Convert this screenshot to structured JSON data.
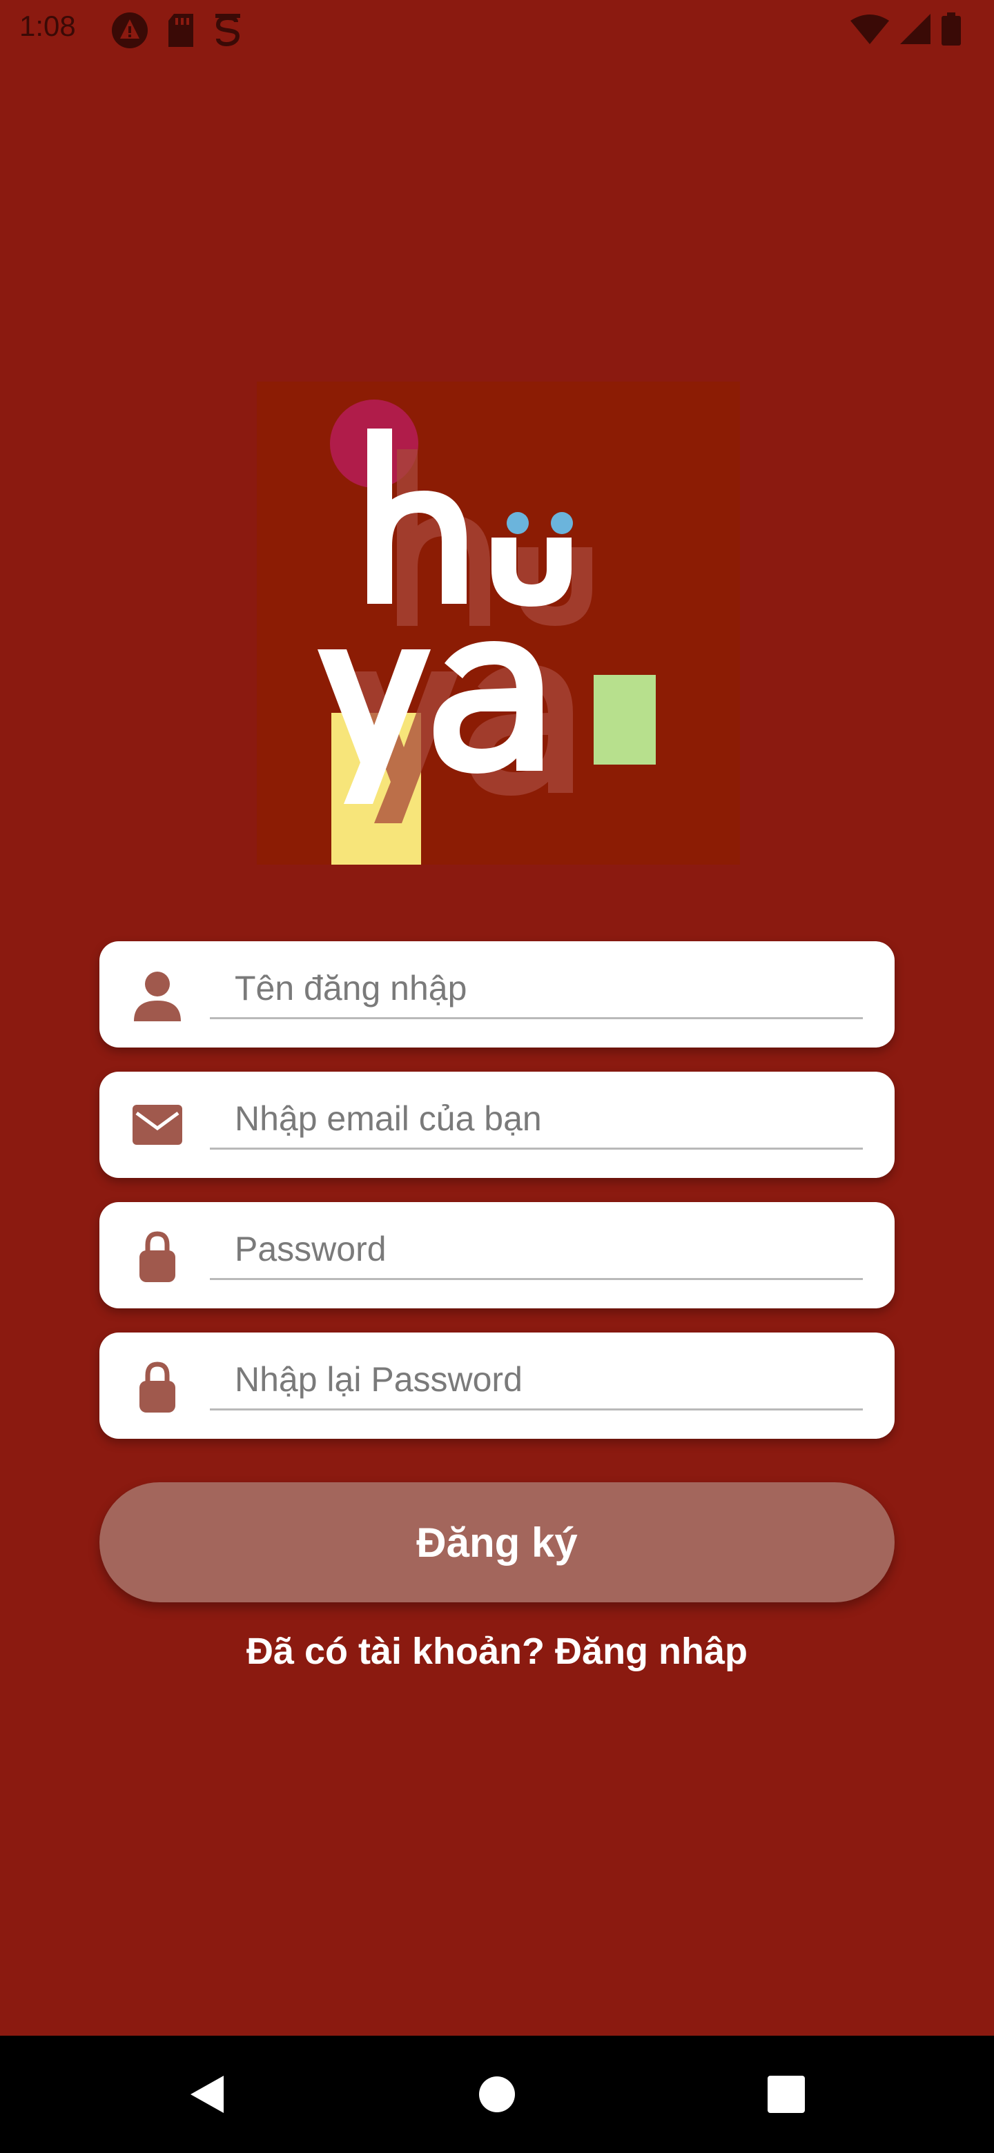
{
  "status_bar": {
    "time": "1:08",
    "left_icons": [
      "alert-icon",
      "sd-card-icon",
      "app-s-icon"
    ],
    "right_icons": [
      "wifi-icon",
      "cell-signal-icon",
      "battery-icon"
    ]
  },
  "logo": {
    "lettering": "hủya",
    "colors": {
      "background": "#8c1c04",
      "magenta": "#b01c4a",
      "blue": "#6bb4dc",
      "yellow": "#f7e57a",
      "green": "#b7e08d"
    }
  },
  "form": {
    "username": {
      "placeholder": "Tên đăng nhập",
      "value": "",
      "icon": "person-icon"
    },
    "email": {
      "placeholder": "Nhập email của bạn",
      "value": "",
      "icon": "mail-icon"
    },
    "password": {
      "placeholder": "Password",
      "value": "",
      "icon": "lock-icon"
    },
    "confirm_password": {
      "placeholder": "Nhập lại Password",
      "value": "",
      "icon": "lock-icon"
    }
  },
  "signup_button": {
    "label": "Đăng ký"
  },
  "login_link": {
    "label": "Đã có tài khoản? Đăng nhâp"
  },
  "nav": {
    "back": "back-icon",
    "home": "home-icon",
    "recents": "recents-icon"
  },
  "colors": {
    "background": "#8b1a10",
    "button": "#a3665c",
    "icon": "#a0594d"
  }
}
